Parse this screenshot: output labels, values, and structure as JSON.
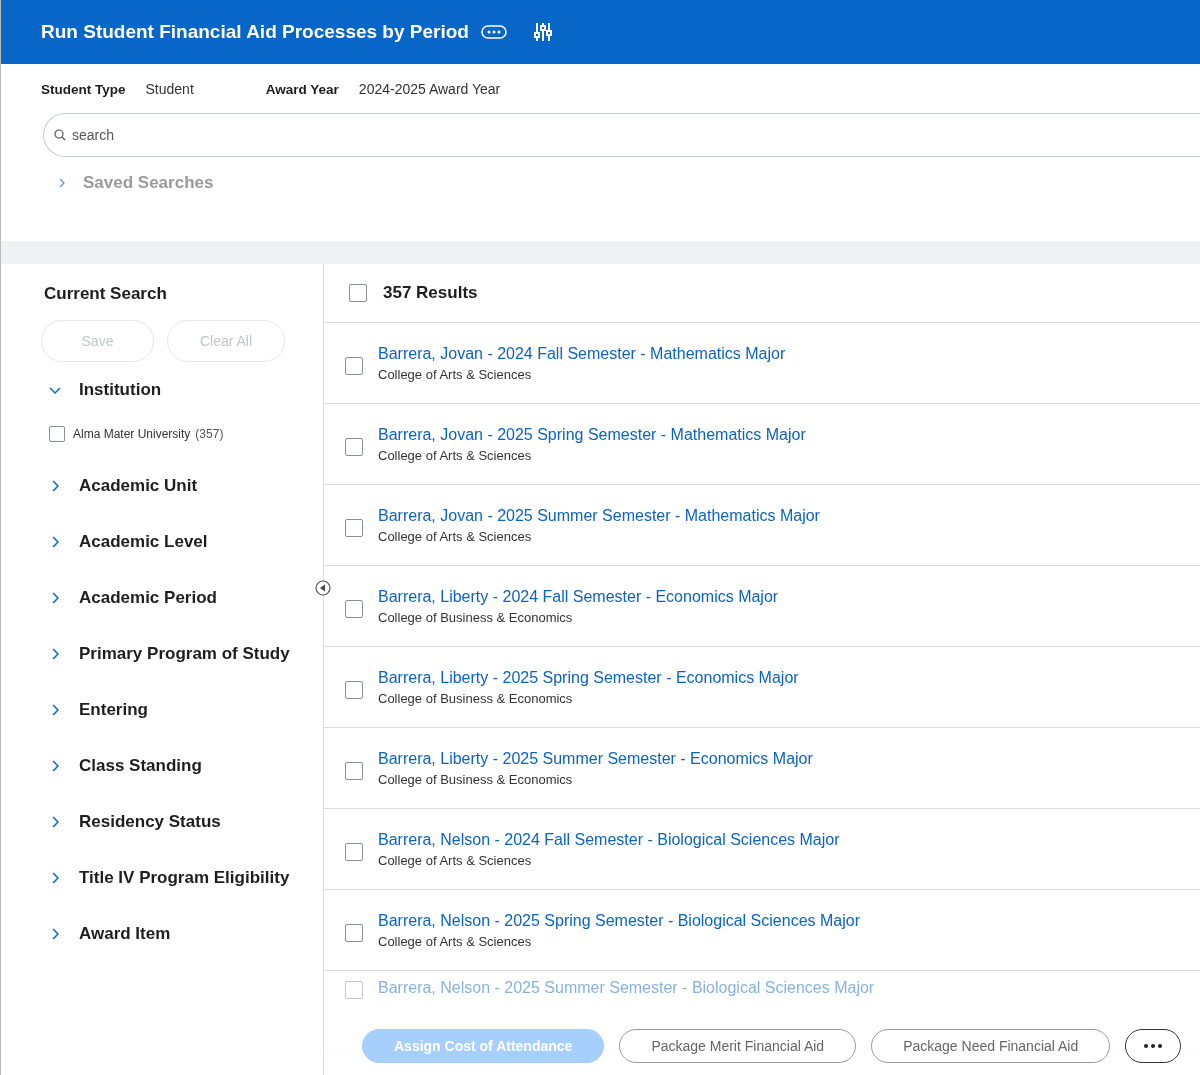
{
  "header": {
    "title": "Run Student Financial Aid Processes by Period"
  },
  "filters": [
    {
      "label": "Student Type",
      "value": "Student"
    },
    {
      "label": "Award Year",
      "value": "2024-2025 Award Year"
    }
  ],
  "search": {
    "placeholder": "search"
  },
  "saved_searches": {
    "label": "Saved Searches",
    "expanded": false
  },
  "sidebar": {
    "title": "Current Search",
    "buttons": [
      {
        "label": "Save",
        "disabled": true
      },
      {
        "label": "Clear All",
        "disabled": true
      }
    ],
    "facets": [
      {
        "label": "Institution",
        "expanded": true,
        "options": [
          {
            "label": "Alma Mater University",
            "count": "(357)",
            "checked": false
          }
        ]
      },
      {
        "label": "Academic Unit",
        "expanded": false
      },
      {
        "label": "Academic Level",
        "expanded": false
      },
      {
        "label": "Academic Period",
        "expanded": false
      },
      {
        "label": "Primary Program of Study",
        "expanded": false
      },
      {
        "label": "Entering",
        "expanded": false
      },
      {
        "label": "Class Standing",
        "expanded": false
      },
      {
        "label": "Residency Status",
        "expanded": false
      },
      {
        "label": "Title IV Program Eligibility",
        "expanded": false
      },
      {
        "label": "Award Item",
        "expanded": false
      }
    ]
  },
  "results": {
    "count_label": "357 Results",
    "all_checked": false,
    "rows": [
      {
        "title": "Barrera, Jovan - 2024 Fall Semester - Mathematics Major",
        "subtitle": "College of Arts & Sciences",
        "checked": false
      },
      {
        "title": "Barrera, Jovan - 2025 Spring Semester - Mathematics Major",
        "subtitle": "College of Arts & Sciences",
        "checked": false
      },
      {
        "title": "Barrera, Jovan - 2025 Summer Semester - Mathematics Major",
        "subtitle": "College of Arts & Sciences",
        "checked": false
      },
      {
        "title": "Barrera, Liberty - 2024 Fall Semester - Economics Major",
        "subtitle": "College of Business & Economics",
        "checked": false
      },
      {
        "title": "Barrera, Liberty - 2025 Spring Semester - Economics Major",
        "subtitle": "College of Business & Economics",
        "checked": false
      },
      {
        "title": "Barrera, Liberty - 2025 Summer Semester - Economics Major",
        "subtitle": "College of Business & Economics",
        "checked": false
      },
      {
        "title": "Barrera, Nelson - 2024 Fall Semester - Biological Sciences Major",
        "subtitle": "College of Arts & Sciences",
        "checked": false
      },
      {
        "title": "Barrera, Nelson - 2025 Spring Semester - Biological Sciences Major",
        "subtitle": "College of Arts & Sciences",
        "checked": false
      },
      {
        "title": "Barrera, Nelson - 2025 Summer Semester - Biological Sciences Major",
        "checked": false
      }
    ]
  },
  "actions": [
    {
      "label": "Assign Cost of Attendance",
      "kind": "primary",
      "disabled": true
    },
    {
      "label": "Package Merit Financial Aid",
      "kind": "secondary",
      "disabled": false
    },
    {
      "label": "Package Need Financial Aid",
      "kind": "secondary",
      "disabled": false
    }
  ]
}
